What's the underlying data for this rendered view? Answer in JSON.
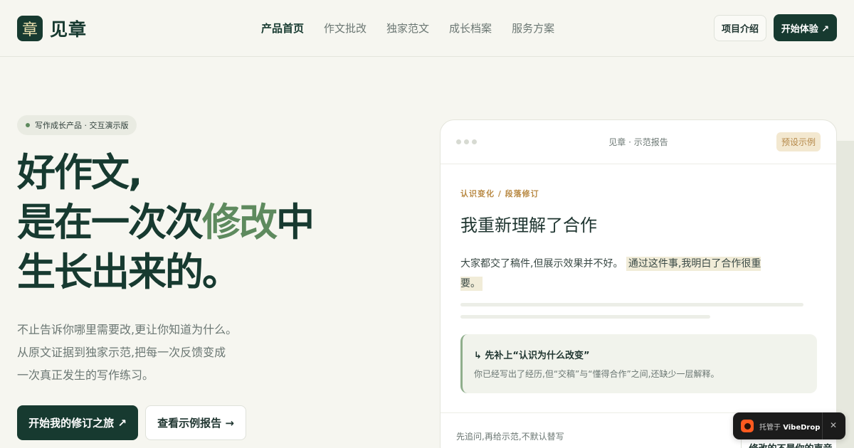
{
  "brand": {
    "logo_char": "章",
    "name": "见章"
  },
  "nav": {
    "items": [
      {
        "label": "产品首页",
        "active": true
      },
      {
        "label": "作文批改",
        "active": false
      },
      {
        "label": "独家范文",
        "active": false
      },
      {
        "label": "成长档案",
        "active": false
      },
      {
        "label": "服务方案",
        "active": false
      }
    ]
  },
  "header": {
    "intro_label": "项目介绍",
    "start_label": "开始体验 ↗"
  },
  "hero": {
    "badge": "写作成长产品 · 交互演示版",
    "title_line1": "好作文,",
    "title_line2_pre": "是在一次次",
    "title_line2_accent": "修改",
    "title_line2_post": "中",
    "title_line3": "生长出来的。",
    "desc_line1": "不止告诉你哪里需要改,更让你知道为什么。",
    "desc_line2": "从原文证据到独家示范,把每一次反馈变成",
    "desc_line3": "一次真正发生的写作练习。",
    "cta_primary": "开始我的修订之旅 ↗",
    "cta_secondary": "查看示例报告 →"
  },
  "report": {
    "title": "见章 · 示范报告",
    "tag": "预设示例",
    "crumb": "认识变化 / 段落修订",
    "heading": "我重新理解了合作",
    "para_plain": "大家都交了稿件,但展示效果并不好。",
    "para_highlight": "通过这件事,我明白了合作很重要。",
    "note_title": "↳ 先补上“认识为什么改变”",
    "note_body": "你已经写出了经历,但“交稿”与“懂得合作”之间,还缺少一层解释。",
    "footer_text": "先追问,再给示范,不默认替写",
    "footer_chip": "修改的不是你的声音"
  },
  "toast": {
    "prefix": "托管于",
    "brand": "VibeDrop",
    "close": "✕"
  },
  "colors": {
    "primary": "#173a30",
    "accent": "#5e8a5e",
    "background": "#f6f6f0",
    "highlight": "#f1ecd8",
    "tag_text": "#b98a45"
  }
}
